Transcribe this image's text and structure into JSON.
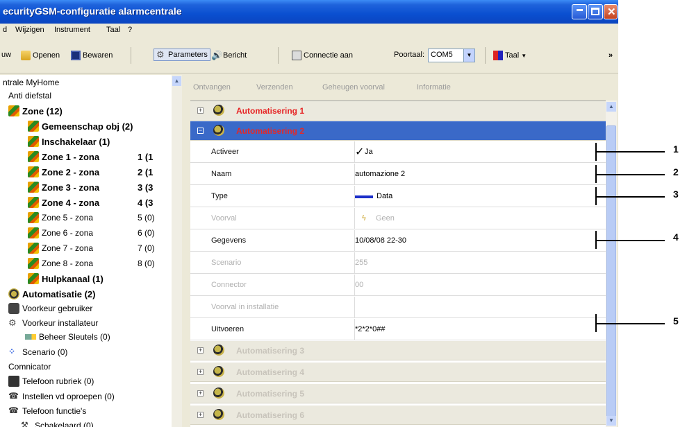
{
  "window": {
    "title": "ecurityGSM-configuratie  alarmcentrale",
    "controls": {
      "minimize": "_",
      "maximize": "□",
      "close": "✕"
    }
  },
  "menu": [
    "d",
    "Wijzigen",
    "Instrument",
    "Taal",
    "?"
  ],
  "toolbar": {
    "new": "uw",
    "open": "Openen",
    "save": "Bewaren",
    "parameters": "Parameters",
    "message": "Bericht",
    "connect": "Connectie aan",
    "port_label": "Poortaal:",
    "port_value": "COM5",
    "language": "Taal",
    "overflow": "»"
  },
  "tree": {
    "root": "ntrale MyHome",
    "anti_theft": "Anti diefstal",
    "zone_group": "Zone (12)",
    "items": [
      {
        "label": "Gemeenschap obj (2)",
        "count": "",
        "bold": true
      },
      {
        "label": "Inschakelaar (1)",
        "count": "",
        "bold": true
      },
      {
        "label": "Zone 1 - zona",
        "count": "1 (1",
        "bold": true
      },
      {
        "label": "Zone 2 - zona",
        "count": "2 (1",
        "bold": true
      },
      {
        "label": "Zone 3 - zona",
        "count": "3 (3",
        "bold": true
      },
      {
        "label": "Zone 4 - zona",
        "count": "4 (3",
        "bold": true
      },
      {
        "label": "Zone 5 - zona",
        "count": "5 (0)",
        "bold": false
      },
      {
        "label": "Zone 6 - zona",
        "count": "6 (0)",
        "bold": false
      },
      {
        "label": "Zone 7 - zona",
        "count": "7 (0)",
        "bold": false
      },
      {
        "label": "Zone 8 - zona",
        "count": "8 (0)",
        "bold": false
      },
      {
        "label": "Hulpkanaal (1)",
        "count": "",
        "bold": true
      }
    ],
    "automation": "Automatisatie (2)",
    "user_pref": "Voorkeur gebruiker",
    "installer_pref": "Voorkeur installateur",
    "key_mgmt": "Beheer Sleutels (0)",
    "scenario": "Scenario (0)",
    "communicator": "Comnicator",
    "phonebook": "Telefoon rubriek (0)",
    "call_settings": "Instellen vd oproepen (0)",
    "phone_functions": "Telefoon functie's",
    "cut_off": "Schakelaard (0)"
  },
  "right_toolbar": [
    "Ontvangen",
    "Verzenden",
    "Geheugen voorval",
    "Informatie"
  ],
  "groups": {
    "g1": "Automatisering 1",
    "g2": "Automatisering 2",
    "g3": "Automatisering 3",
    "g4": "Automatisering 4",
    "g5": "Automatisering 5",
    "g6": "Automatisering 6"
  },
  "properties": [
    {
      "key": "Activeer",
      "value": "Ja"
    },
    {
      "key": "Naam",
      "value": "automazione 2"
    },
    {
      "key": "Type",
      "value": "Data"
    },
    {
      "key": "Voorval",
      "value": "Geen"
    },
    {
      "key": "Gegevens",
      "value": "10/08/08 22-30"
    },
    {
      "key": "Scenario",
      "value": "255"
    },
    {
      "key": "Connector",
      "value": "00"
    },
    {
      "key": "Voorval in installatie",
      "value": ""
    },
    {
      "key": "Uitvoeren",
      "value": "*2*2*0##"
    }
  ],
  "callouts": [
    "1",
    "2",
    "3",
    "4",
    "5"
  ],
  "colors": {
    "title_blue": "#0a4fd0",
    "selection": "#3a69c8",
    "accent_red": "#e62525"
  }
}
